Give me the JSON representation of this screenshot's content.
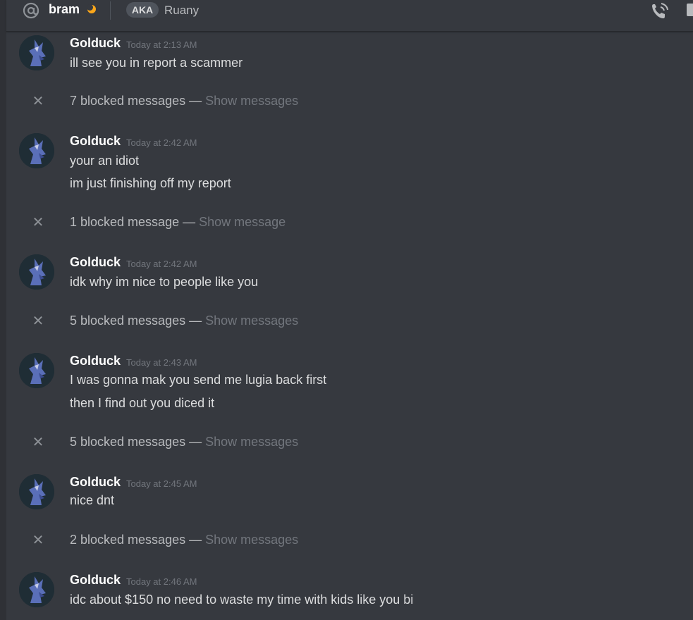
{
  "header": {
    "username": "bram",
    "aka_label": "AKA",
    "aka_name": "Ruany",
    "icons": [
      "at-icon",
      "moon-status-icon",
      "voice-call-icon",
      "video-call-icon"
    ]
  },
  "colors": {
    "background": "#36393f",
    "author": "#ffffff",
    "timestamp": "#72767d",
    "message_text": "#dcddde",
    "idle_status": "#faa61a"
  },
  "messages": [
    {
      "author": "Golduck",
      "timestamp": "Today at 2:13 AM",
      "lines": [
        "ill see you in report a scammer"
      ]
    },
    {
      "blocked": "7 blocked messages — ",
      "show": "Show messages"
    },
    {
      "author": "Golduck",
      "timestamp": "Today at 2:42 AM",
      "lines": [
        "your an idiot",
        "im just finishing off my report"
      ]
    },
    {
      "blocked": "1 blocked message — ",
      "show": "Show message"
    },
    {
      "author": "Golduck",
      "timestamp": "Today at 2:42 AM",
      "lines": [
        "idk why im nice to people like you"
      ]
    },
    {
      "blocked": "5 blocked messages — ",
      "show": "Show messages"
    },
    {
      "author": "Golduck",
      "timestamp": "Today at 2:43 AM",
      "lines": [
        "I was gonna mak you send me lugia back first",
        "then I find out you diced it"
      ]
    },
    {
      "blocked": "5 blocked messages — ",
      "show": "Show messages"
    },
    {
      "author": "Golduck",
      "timestamp": "Today at 2:45 AM",
      "lines": [
        "nice dnt"
      ]
    },
    {
      "blocked": "2 blocked messages — ",
      "show": "Show messages"
    },
    {
      "author": "Golduck",
      "timestamp": "Today at 2:46 AM",
      "lines": [
        "idc about $150 no need to waste my time with kids like you bi"
      ]
    }
  ]
}
